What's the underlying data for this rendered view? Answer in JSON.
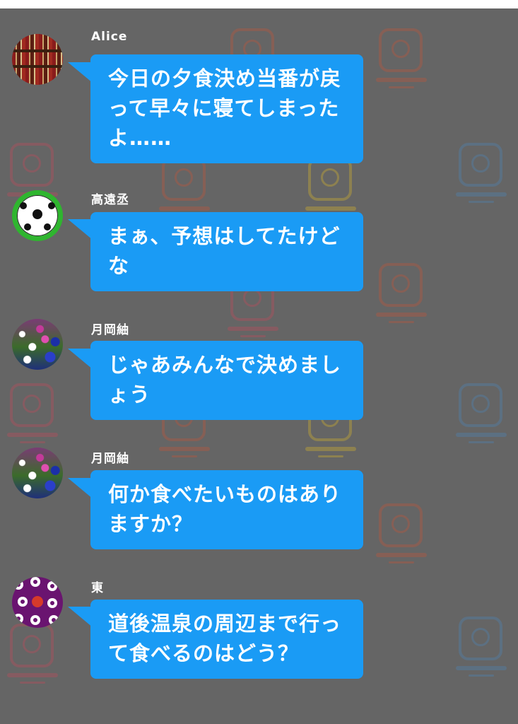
{
  "messages": [
    {
      "sender": "Alice",
      "avatar_icon": "bookshelf-avatar",
      "text": "今日の夕食決め当番が戻って早々に寝てしまったよ……"
    },
    {
      "sender": "高遠丞",
      "avatar_icon": "soccer-ball-avatar",
      "text": "まぁ、予想はしてたけどな"
    },
    {
      "sender": "月岡紬",
      "avatar_icon": "flowers-avatar",
      "text": "じゃあみんなで決めましょう"
    },
    {
      "sender": "月岡紬",
      "avatar_icon": "flowers-avatar",
      "text": "何か食べたいものはありますか？"
    },
    {
      "sender": "東",
      "avatar_icon": "camellia-pattern-avatar",
      "text": "道後温泉の周辺まで行って食べるのはどう？"
    }
  ],
  "colors": {
    "background": "#656565",
    "bubble": "#1a9bf5",
    "text": "#ffffff",
    "stamp_spring": "#c44a5a",
    "stamp_summer": "#d8b52a",
    "stamp_autumn": "#c4553a",
    "stamp_winter": "#4d86b8"
  }
}
